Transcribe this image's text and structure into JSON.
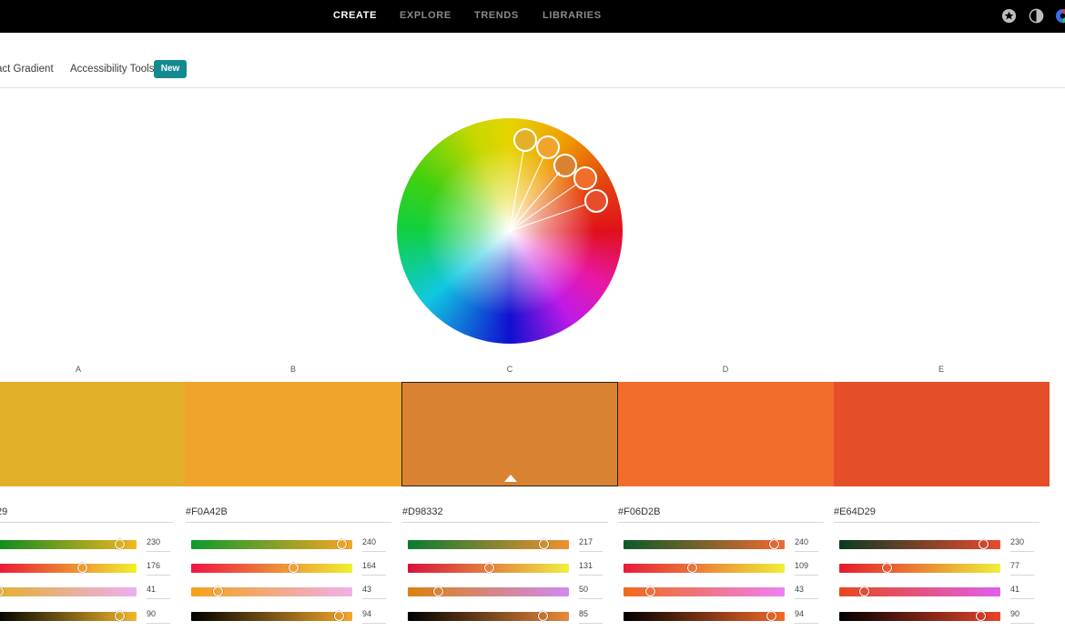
{
  "topnav": {
    "items": [
      {
        "label": "CREATE",
        "active": true
      },
      {
        "label": "EXPLORE",
        "active": false
      },
      {
        "label": "TRENDS",
        "active": false
      },
      {
        "label": "LIBRARIES",
        "active": false
      }
    ],
    "icons": [
      "star-icon",
      "contrast-icon",
      "app-logo-icon"
    ]
  },
  "subnav": {
    "links": [
      "act Gradient",
      "Accessibility Tools"
    ],
    "badge": "New"
  },
  "wheel": {
    "selected_swatch": "C",
    "marker_colors": [
      "#E3B129",
      "#F0A42B",
      "#D98332",
      "#F06D2B",
      "#E64D29"
    ]
  },
  "swatches": [
    {
      "label": "A",
      "color": "#E3B129",
      "hex": "29",
      "values": [
        "230",
        "176",
        "41",
        "90"
      ],
      "positions": [
        0.88,
        0.62,
        0.02,
        0.88
      ]
    },
    {
      "label": "B",
      "color": "#F0A42B",
      "hex": "#F0A42B",
      "values": [
        "240",
        "164",
        "43",
        "94"
      ],
      "positions": [
        0.94,
        0.64,
        0.17,
        0.92
      ]
    },
    {
      "label": "C",
      "color": "#D98332",
      "hex": "#D98332",
      "values": [
        "217",
        "131",
        "50",
        "85"
      ],
      "positions": [
        0.85,
        0.51,
        0.19,
        0.84
      ]
    },
    {
      "label": "D",
      "color": "#F06D2B",
      "hex": "#F06D2B",
      "values": [
        "240",
        "109",
        "43",
        "94"
      ],
      "positions": [
        0.94,
        0.43,
        0.17,
        0.92
      ]
    },
    {
      "label": "E",
      "color": "#E64D29",
      "hex": "#E64D29",
      "values": [
        "230",
        "77",
        "41",
        "90"
      ],
      "positions": [
        0.9,
        0.3,
        0.16,
        0.88
      ]
    }
  ]
}
